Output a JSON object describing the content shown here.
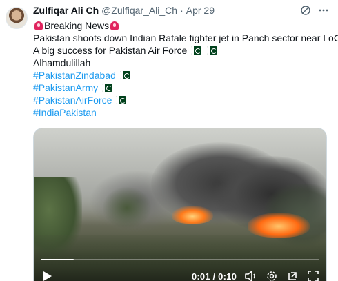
{
  "author": {
    "name": "Zulfiqar Ali Ch",
    "handle": "@Zulfiqar_Ali_Ch",
    "separator": "·",
    "date": "Apr 29"
  },
  "header_icons": [
    "grok-icon",
    "more-icon"
  ],
  "tweet": {
    "line1": "Breaking News",
    "line2": "Pakistan shoots down Indian Rafale fighter jet in Panch sector near LoC",
    "line3": "A big success for Pakistan Air Force",
    "line4": "Alhamdulillah",
    "hashtags": [
      "#PakistanZindabad",
      "#PakistanArmy",
      "#PakistanAirForce",
      "#IndiaPakistan"
    ]
  },
  "video": {
    "progress": 0.12,
    "time": "0:01 / 0:10",
    "icons": [
      "play-icon",
      "volume-icon",
      "settings-icon",
      "pop-out-icon",
      "fullscreen-icon"
    ]
  },
  "colors": {
    "link": "#1d9bf0",
    "secondary_text": "#536471",
    "primary_text": "#0f1419",
    "flag_green": "#01411c"
  }
}
